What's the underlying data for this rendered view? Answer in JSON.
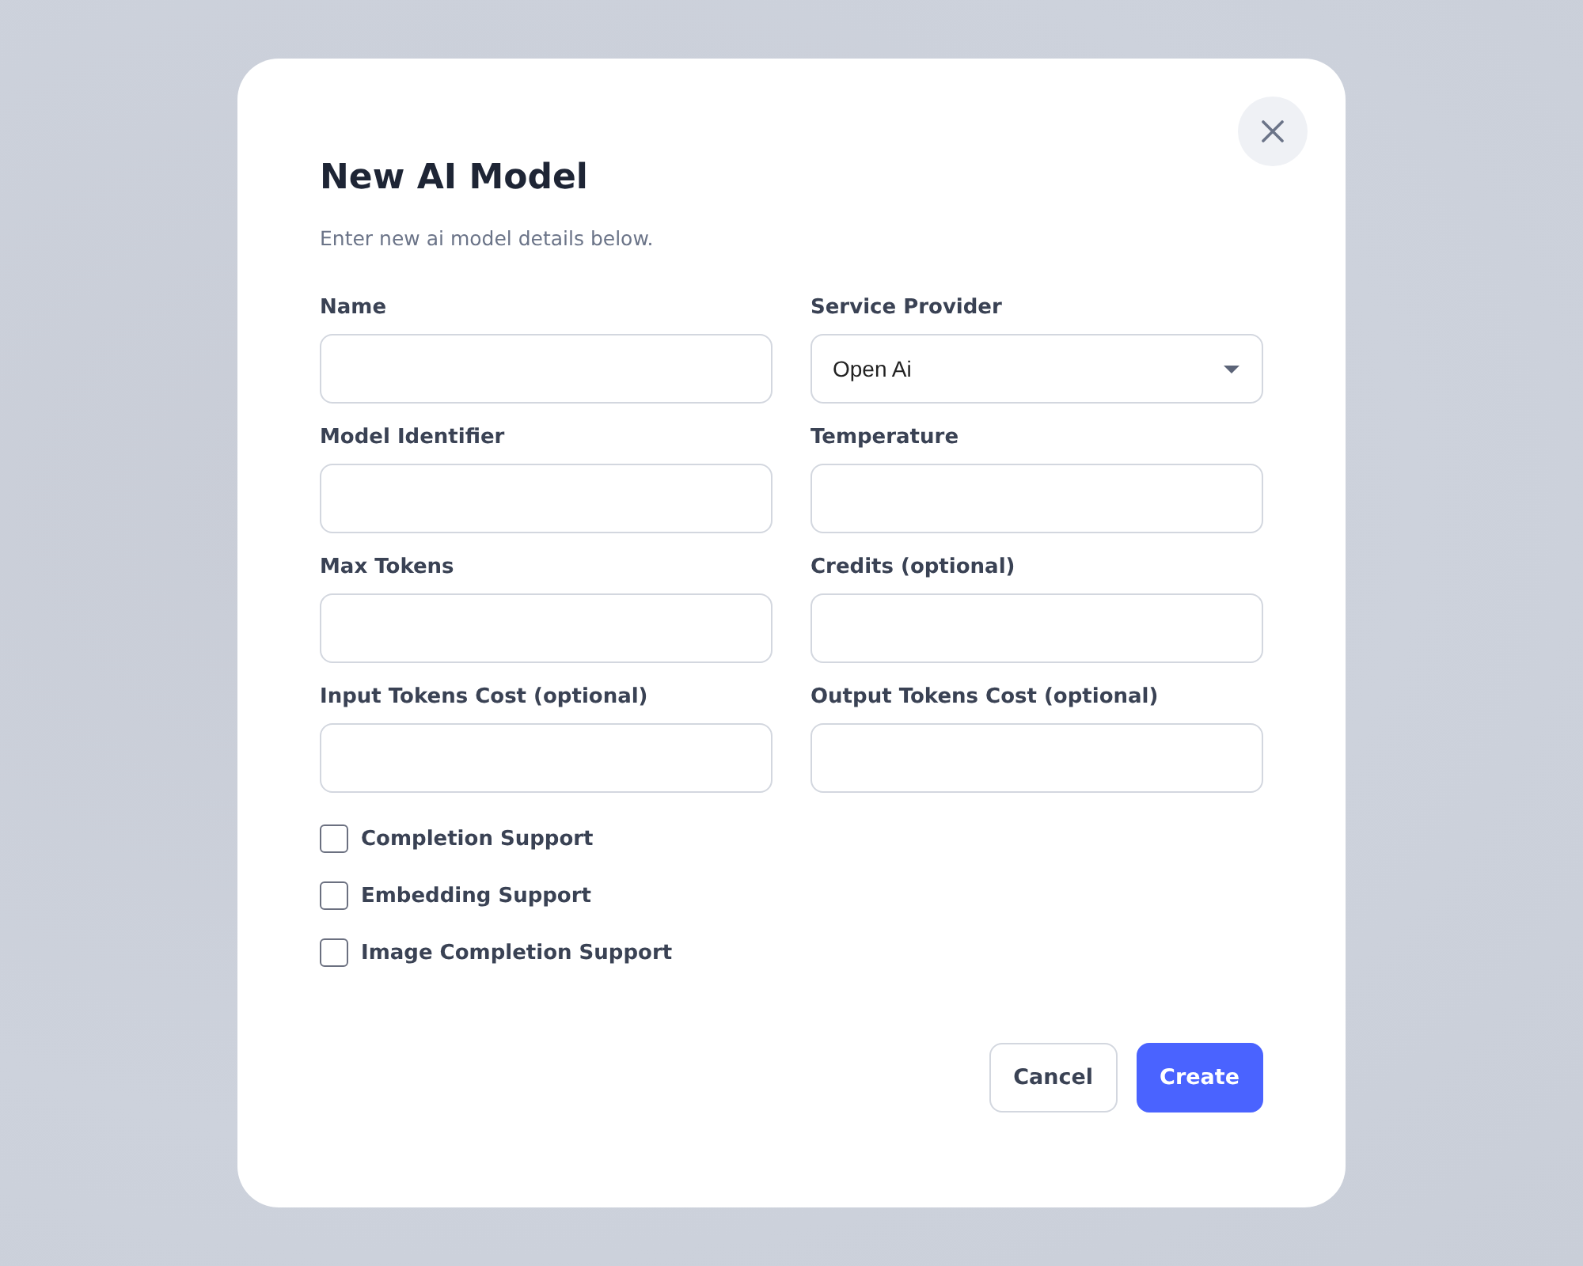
{
  "dialog": {
    "title": "New AI Model",
    "subtitle": "Enter new ai model details below.",
    "fields": [
      {
        "label": "Name",
        "kind": "text"
      },
      {
        "label": "Service Provider",
        "kind": "select",
        "value": "Open Ai"
      },
      {
        "label": "Model Identifier",
        "kind": "text"
      },
      {
        "label": "Temperature",
        "kind": "text"
      },
      {
        "label": "Max Tokens",
        "kind": "text"
      },
      {
        "label": "Credits (optional)",
        "kind": "text"
      },
      {
        "label": "Input Tokens Cost (optional)",
        "kind": "text"
      },
      {
        "label": "Output Tokens Cost (optional)",
        "kind": "text"
      }
    ],
    "checkboxes": [
      {
        "label": "Completion Support",
        "checked": false
      },
      {
        "label": "Embedding Support",
        "checked": false
      },
      {
        "label": "Image Completion Support",
        "checked": false
      }
    ],
    "buttons": [
      {
        "label": "Cancel",
        "kind": "secondary"
      },
      {
        "label": "Create",
        "kind": "primary"
      }
    ]
  }
}
